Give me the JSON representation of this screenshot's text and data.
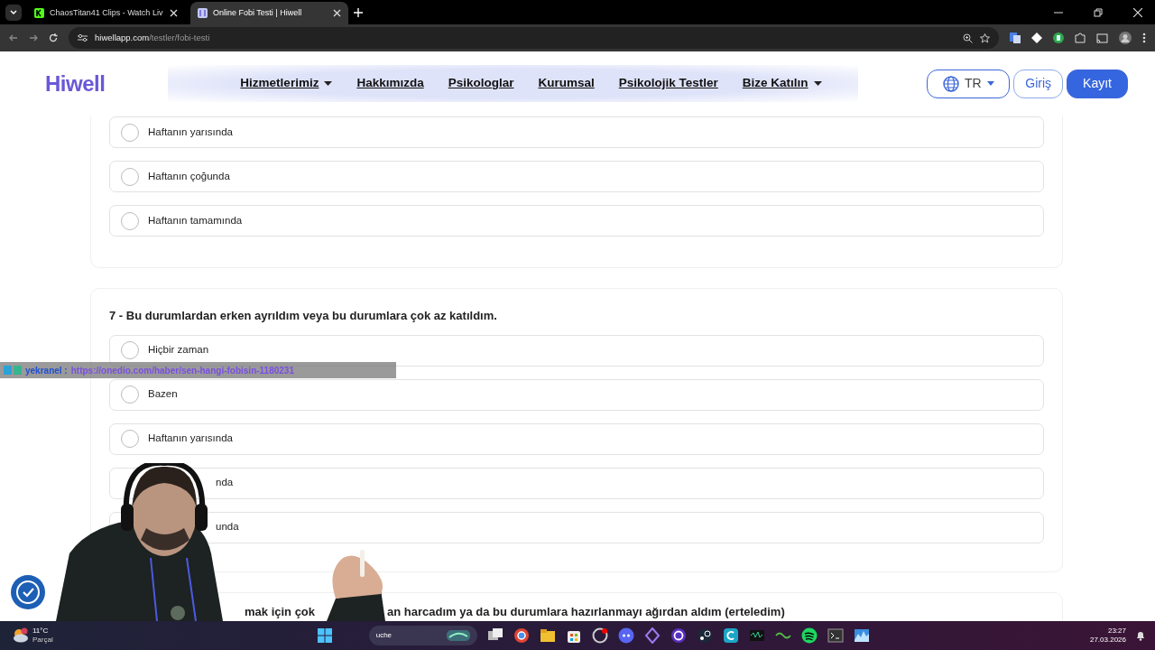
{
  "browser": {
    "tabs": [
      {
        "title": "ChaosTitan41 Clips - Watch Liv",
        "selected": false
      },
      {
        "title": "Online Fobi Testi | Hiwell",
        "selected": true
      }
    ],
    "url_host": "hiwellapp.com",
    "url_path": "/testler/fobi-testi"
  },
  "site": {
    "logo": "Hiwell",
    "nav": [
      {
        "label": "Hizmetlerimiz",
        "dropdown": true
      },
      {
        "label": "Hakkımızda",
        "dropdown": false
      },
      {
        "label": "Psikologlar",
        "dropdown": false
      },
      {
        "label": "Kurumsal",
        "dropdown": false
      },
      {
        "label": "Psikolojik Testler",
        "dropdown": false
      },
      {
        "label": "Bize Katılın",
        "dropdown": true
      }
    ],
    "language": "TR",
    "login": "Giriş",
    "register": "Kayıt"
  },
  "questions": [
    {
      "options": [
        {
          "label": "Haftanın yarısında",
          "selected": false
        },
        {
          "label": "Haftanın çoğunda",
          "selected": false
        },
        {
          "label": "Haftanın tamamında",
          "selected": false
        }
      ]
    },
    {
      "title": "7 - Bu durumlardan erken ayrıldım veya bu durumlara çok az katıldım.",
      "options": [
        {
          "label": "Hiçbir zaman",
          "selected": false
        },
        {
          "label": "Bazen",
          "selected": false
        },
        {
          "label": "Haftanın yarısında",
          "selected": false
        },
        {
          "label": "nda",
          "covered": true
        },
        {
          "label": "unda",
          "covered": true
        }
      ]
    },
    {
      "title_parts": [
        "mak için çok",
        "an harcadım ya da bu durumlara hazırlanmayı ağırdan aldım (erteledim)"
      ]
    }
  ],
  "chat": {
    "user": "yekranel :",
    "message": "https://onedio.com/haber/sen-hangi-fobisin-1180231"
  },
  "taskbar": {
    "temperature": "11°C",
    "weather_label": "Parçal",
    "search": "uche",
    "time": "23:27",
    "date": "27.03.2026"
  }
}
